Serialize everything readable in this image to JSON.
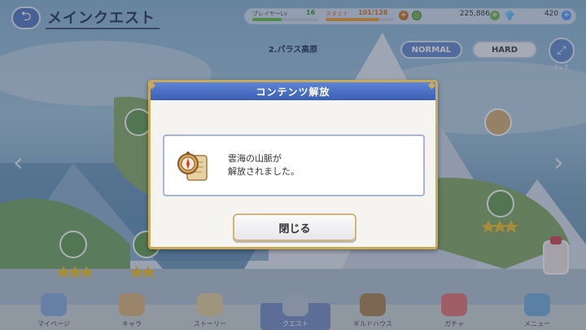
{
  "header": {
    "back_icon": "back-arrow-icon",
    "title": "メインクエスト"
  },
  "stats": {
    "player_level_label": "プレイヤーLv",
    "player_level": "16",
    "stamina_label": "スタミナ",
    "stamina": "101/128",
    "stamina_fill": 0.79,
    "exp_fill": 0.45,
    "mana": "225,886",
    "gems": "420"
  },
  "area": {
    "name": "2.パラス高原",
    "normal_label": "NORMAL",
    "hard_label": "HARD",
    "map_label": "マップ"
  },
  "modal": {
    "title": "コンテンツ解放",
    "message_line1": "雲海の山脈が",
    "message_line2": "解放されました。",
    "close_label": "閉じる",
    "icon": "compass-scroll-icon"
  },
  "nav": {
    "items": [
      {
        "label": "マイページ"
      },
      {
        "label": "キャラ"
      },
      {
        "label": "ストーリー"
      },
      {
        "label": "クエスト"
      },
      {
        "label": "ギルドハウス"
      },
      {
        "label": "ガチャ"
      },
      {
        "label": "メニュー"
      }
    ]
  },
  "colors": {
    "modal_header": "#3b5fb5",
    "modal_border": "#c9a95a",
    "normal_button": "#6a8ed0"
  }
}
